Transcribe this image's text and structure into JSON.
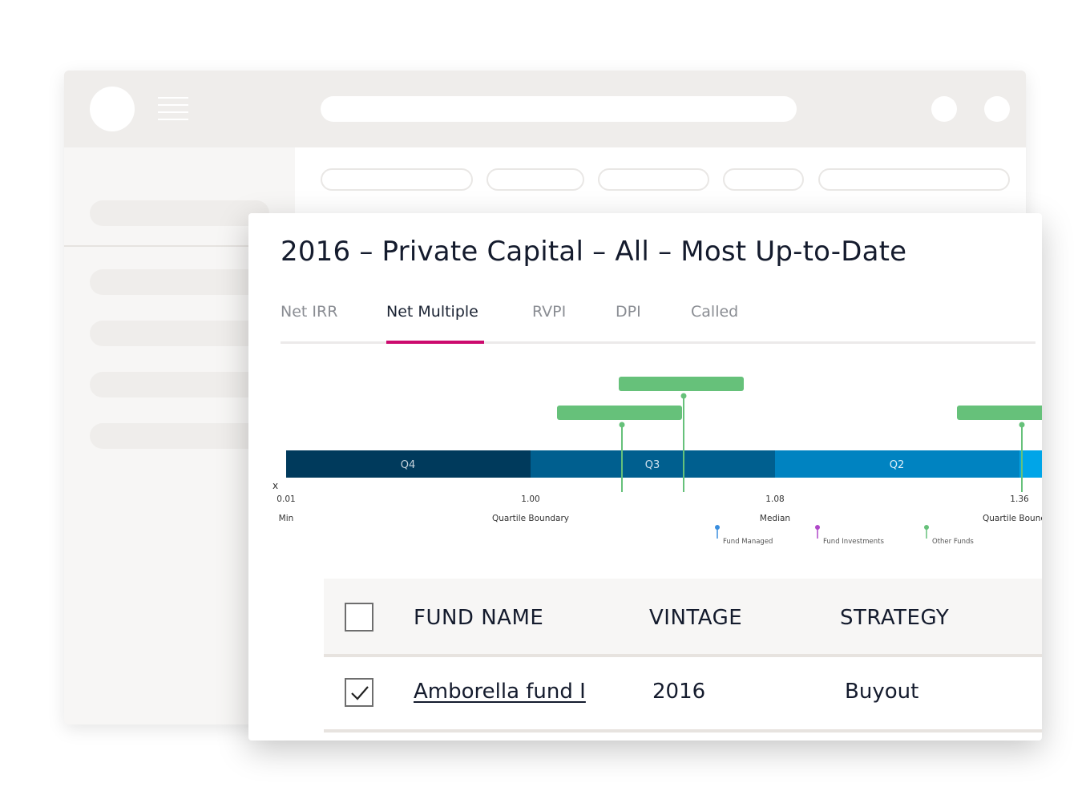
{
  "card": {
    "title": "2016 – Private Capital – All – Most Up-to-Date"
  },
  "tabs": [
    {
      "label": "Net IRR",
      "active": false
    },
    {
      "label": "Net Multiple",
      "active": true
    },
    {
      "label": "RVPI",
      "active": false
    },
    {
      "label": "DPI",
      "active": false
    },
    {
      "label": "Called",
      "active": false
    }
  ],
  "colors": {
    "accent": "#cc0a6e",
    "q4": "#003a5c",
    "q3": "#005f8f",
    "q2": "#0083c1",
    "q1": "#00a5e8",
    "other_funds": "#66c17a",
    "fund_managed": "#3a8ede",
    "fund_investments": "#b048c8"
  },
  "chart_data": {
    "type": "quartile-bar",
    "quartiles": [
      {
        "label": "Q4"
      },
      {
        "label": "Q3"
      },
      {
        "label": "Q2"
      }
    ],
    "axis_symbol": "x",
    "tick_labels": [
      "0.01",
      "1.00",
      "1.08",
      "1.36"
    ],
    "boundary_labels": [
      "Min",
      "Quartile Boundary",
      "Median",
      "Quartile Boundary"
    ],
    "legend": [
      {
        "label": "Fund Managed",
        "color": "#3a8ede"
      },
      {
        "label": "Fund Investments",
        "color": "#b048c8"
      },
      {
        "label": "Other Funds",
        "color": "#66c17a"
      }
    ],
    "series": [
      {
        "name": "Other Funds",
        "count_markers": 3
      }
    ]
  },
  "table": {
    "headers": [
      "FUND NAME",
      "VINTAGE",
      "STRATEGY"
    ],
    "header_checkbox_checked": false,
    "rows": [
      {
        "checked": true,
        "fund_name": "Amborella fund I",
        "vintage": "2016",
        "strategy": "Buyout"
      }
    ]
  }
}
